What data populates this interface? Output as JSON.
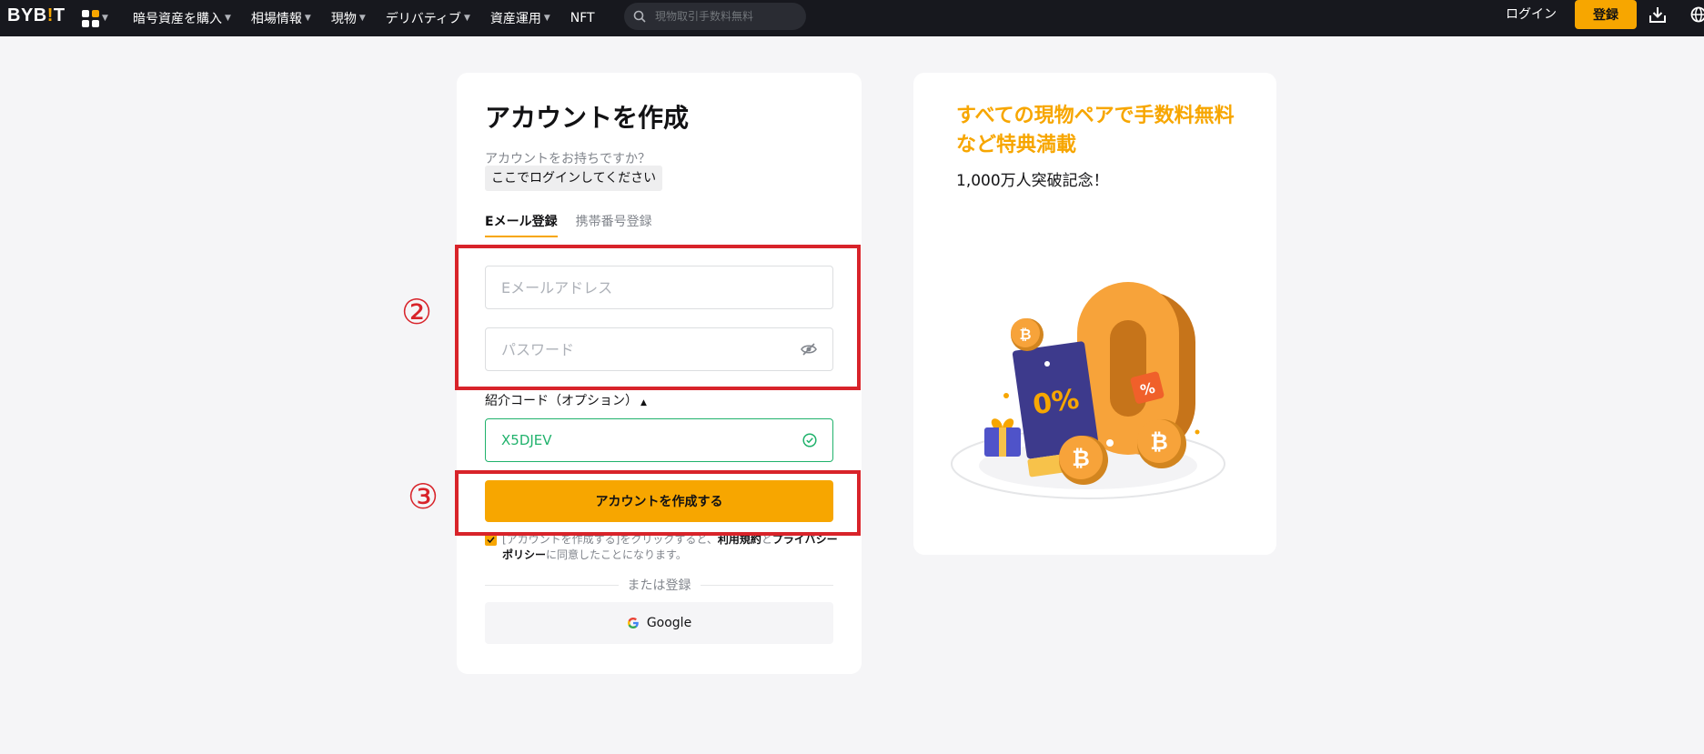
{
  "brand": {
    "logo_text": "BYB",
    "logo_bang": "!",
    "logo_tail": "T",
    "accent": "#f7a600"
  },
  "nav": {
    "items": [
      {
        "label": "暗号資産を購入",
        "caret": true
      },
      {
        "label": "相場情報",
        "caret": true
      },
      {
        "label": "現物",
        "caret": true
      },
      {
        "label": "デリバティブ",
        "caret": true
      },
      {
        "label": "資産運用",
        "caret": true
      },
      {
        "label": "NFT",
        "caret": false
      }
    ],
    "search_placeholder": "現物取引手数料無料",
    "login_label": "ログイン",
    "register_label": "登録"
  },
  "form": {
    "title": "アカウントを作成",
    "have_account": "アカウントをお持ちですか？",
    "login_here": "ここでログインしてください",
    "tabs": [
      {
        "label": "Eメール登録",
        "active": true
      },
      {
        "label": "携帯番号登録",
        "active": false
      }
    ],
    "email_placeholder": "Eメールアドレス",
    "password_placeholder": "パスワード",
    "referral_label": "紹介コード（オプション）",
    "referral_value": "X5DJEV",
    "create_button": "アカウントを作成する",
    "terms_prefix": "[アカウントを作成する]をクリックすると、",
    "terms_link": "利用規約",
    "terms_and": "と",
    "privacy_link": "プライバシーポリシー",
    "terms_suffix": "に同意したことになります。",
    "or_register": "または登録",
    "google_label": "Google"
  },
  "promo": {
    "title": "すべての現物ペアで手数料無料など特典満載",
    "subtitle": "1,000万人突破記念！",
    "ticket_text": "0%",
    "tag_text": "%"
  },
  "annotations": {
    "marker_2": "②",
    "marker_3": "③",
    "color": "#d8232a"
  }
}
